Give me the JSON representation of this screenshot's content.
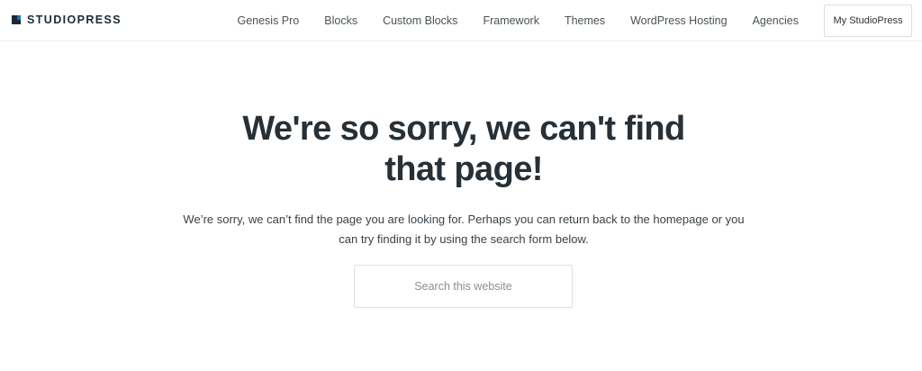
{
  "header": {
    "logo_text": "STUDIOPRESS",
    "nav": [
      {
        "label": "Genesis Pro"
      },
      {
        "label": "Blocks"
      },
      {
        "label": "Custom Blocks"
      },
      {
        "label": "Framework"
      },
      {
        "label": "Themes"
      },
      {
        "label": "WordPress Hosting"
      },
      {
        "label": "Agencies"
      }
    ],
    "cta_label": "My StudioPress"
  },
  "main": {
    "title": "We're so sorry, we can't find that page!",
    "description": "We’re sorry, we can’t find the page you are looking for. Perhaps you can return back to the homepage or you can try finding it by using the search form below.",
    "search": {
      "placeholder": "Search this website",
      "value": ""
    }
  },
  "colors": {
    "brand_dark": "#1e2a33",
    "brand_blue": "#0a7cc1",
    "text": "#2b3236",
    "border": "#dcdfe1"
  }
}
